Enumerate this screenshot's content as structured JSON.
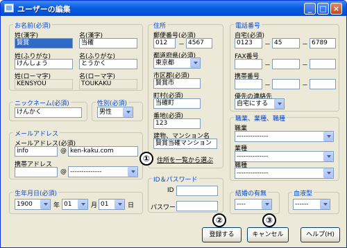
{
  "window": {
    "title": "ユーザーの編集",
    "min": "_",
    "max": "□",
    "close": "×"
  },
  "name_group": {
    "legend": "お名前(必須)",
    "last_kanji_label": "姓(漢字)",
    "last_kanji_value": "賢賞",
    "first_kanji_label": "名(漢字)",
    "first_kanji_value": "当確",
    "last_kana_label": "姓(ふりがな)",
    "last_kana_value": "けんしょう",
    "first_kana_label": "名(ふりがな)",
    "first_kana_value": "とうかく",
    "last_roma_label": "姓(ローマ字)",
    "last_roma_value": "KENSYOU",
    "first_roma_label": "名(ローマ字)",
    "first_roma_value": "TOUKAKU"
  },
  "nickname_group": {
    "legend": "ニックネーム(必須)",
    "value": "けんかく"
  },
  "gender_group": {
    "legend": "性別(必須)",
    "value": "男性"
  },
  "mail_group": {
    "legend": "メールアドレス",
    "pc_label": "メールアドレス(必須)",
    "pc_user": "info",
    "at": "@",
    "pc_domain": "ken-kaku.com",
    "mobile_label": "携帯アドレス",
    "mobile_user": "",
    "mobile_domain": "--------------"
  },
  "birthday_group": {
    "legend": "生年月日(必須)",
    "year": "1900",
    "year_unit": "年",
    "month": "01",
    "month_unit": "月",
    "day": "01",
    "day_unit": "日"
  },
  "address_group": {
    "legend": "住所",
    "zip_label": "郵便番号(必須)",
    "zip1": "012",
    "zip2": "4567",
    "pref_label": "都道府県(必須)",
    "pref_value": "東京都",
    "city_label": "市区郡(必須)",
    "city_value": "賢賞市",
    "town_label": "町村(必須)",
    "town_value": "当確町",
    "banchi_label": "番地(必須)",
    "banchi_value": "123",
    "building_label": "建物、マンション名",
    "building_value": "賢賞当確マンション",
    "select_link": "住所を一覧から選ぶ"
  },
  "id_group": {
    "legend": "ID＆パスワード",
    "id_label": "ID",
    "id_value": "",
    "pw_label": "パスワード",
    "pw_value": ""
  },
  "phone_group": {
    "legend": "電話番号",
    "home_label": "自宅(必須)",
    "home1": "0123",
    "home2": "45",
    "home3": "6789",
    "fax_label": "FAX番号",
    "mobile_label": "携帯番号",
    "priority_label": "優先の連絡先",
    "priority_value": "自宅にする"
  },
  "job_group": {
    "legend": "職業、業種、職種",
    "job_label": "職業",
    "job_value": "--------------",
    "industry_label": "業種",
    "industry_value": "--------------",
    "type_label": "職種",
    "type_value": "--------------"
  },
  "married_group": {
    "legend": "結婚の有無",
    "value": "----"
  },
  "blood_group": {
    "legend": "血液型",
    "value": "------"
  },
  "buttons": {
    "register": "登録する",
    "cancel": "キャンセル",
    "help": "ヘルプ(H)"
  },
  "markers": {
    "m1": "①",
    "m2": "②",
    "m3": "③"
  },
  "separator": "－"
}
